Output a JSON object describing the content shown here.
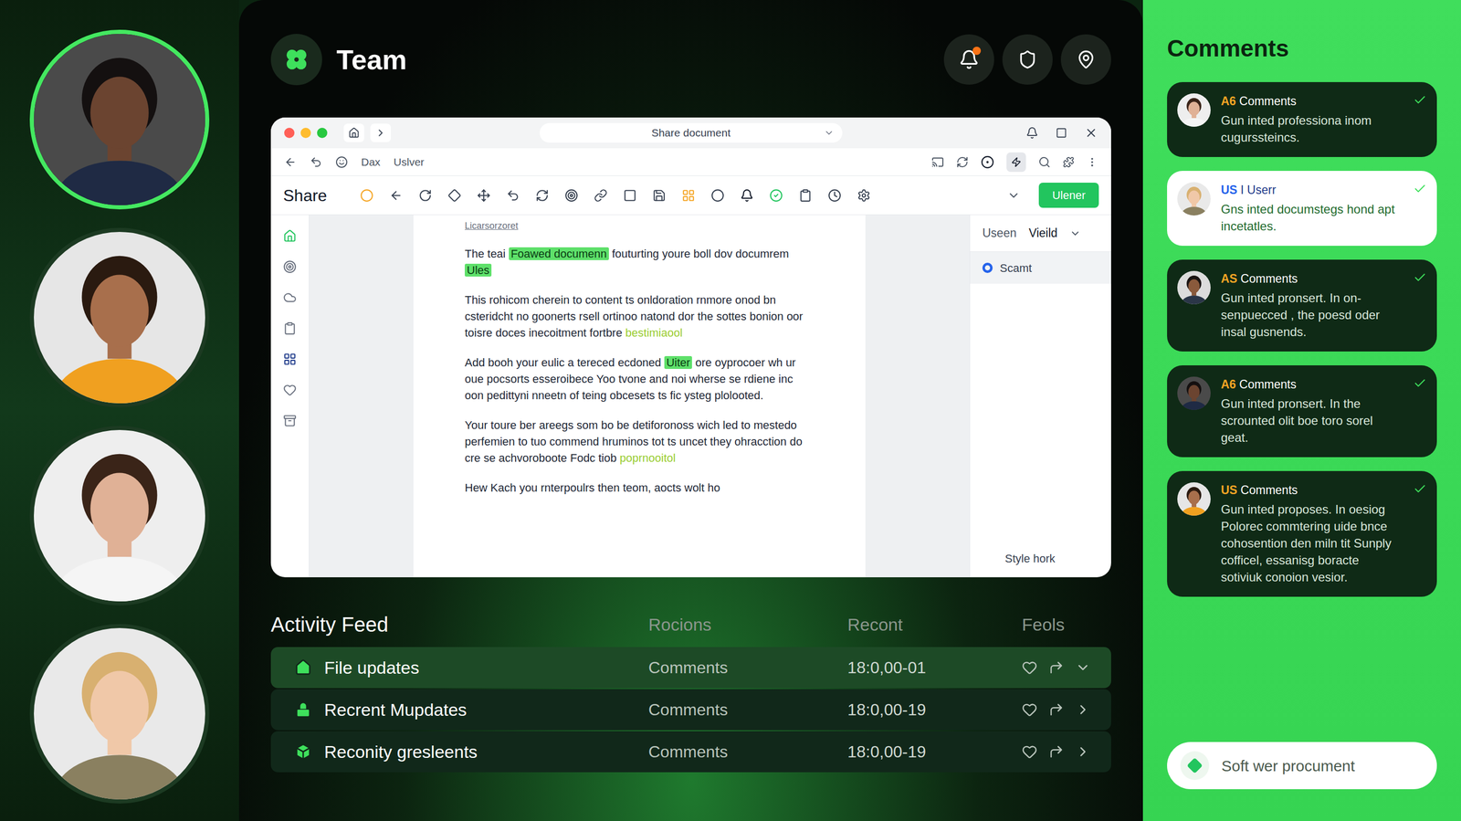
{
  "team": [
    {
      "selected": true
    },
    {
      "selected": false
    },
    {
      "selected": false
    },
    {
      "selected": false
    }
  ],
  "header": {
    "title": "Team",
    "has_notifications": true
  },
  "browser": {
    "title": "Share document",
    "breadcrumbs": [
      "Dax",
      "Uslver"
    ],
    "toolbar": {
      "title": "Share",
      "button": "Ulener"
    },
    "document": {
      "heading": "Licarsorzoret",
      "paragraphs": [
        [
          {
            "text": "The teai",
            "kind": "plain"
          },
          {
            "text": "Foawed documenn",
            "kind": "highlight"
          },
          {
            "text": "fouturting youre boll dov documrem",
            "kind": "plain"
          },
          {
            "text": "Ules",
            "kind": "highlight"
          }
        ],
        [
          {
            "text": "This rohicom cherein to content ts onldoration rnmore onod bn csteridcht no goonerts rsell ortinoo natond dor the sottes bonion oor toisre doces inecoitment fortbre",
            "kind": "plain"
          },
          {
            "text": "bestimiaool",
            "kind": "link"
          }
        ],
        [
          {
            "text": "Add booh your eulic a tereced ecdoned",
            "kind": "plain"
          },
          {
            "text": "Uiter",
            "kind": "highlight"
          },
          {
            "text": "ore oyprocoer wh ur oue pocsorts esseroibece Yoo tvone and noi wherse se rdiene inc oon pedittyni nneetn of teing obcesets ts fic ysteg plolooted.",
            "kind": "plain"
          }
        ],
        [
          {
            "text": "Your toure ber areegs som bo be detiforonoss wich led to mestedo perfemien to tuo commend hruminos tot ts uncet they ohracction do cre se achvoroboote Fodc tiob",
            "kind": "plain"
          },
          {
            "text": "poprnooitol",
            "kind": "link"
          }
        ],
        [
          {
            "text": "Hew Kach you rnterpoulrs then teom, aocts wolt ho",
            "kind": "plain"
          }
        ]
      ]
    },
    "side_panel": {
      "tabs": [
        {
          "label": "Useen",
          "selected": false
        },
        {
          "label": "Vieild",
          "selected": true
        }
      ],
      "items": [
        {
          "label": "Scamt",
          "selected": true
        }
      ],
      "footer": "Style hork"
    }
  },
  "activity_feed": {
    "title": "Activity Feed",
    "columns": [
      "Rocions",
      "Recont",
      "Feols"
    ],
    "rows": [
      {
        "title": "File updates",
        "type": "Comments",
        "time": "18:0,00-01",
        "expanded": true,
        "selected": true
      },
      {
        "title": "Recrent Mupdates",
        "type": "Comments",
        "time": "18:0,00-19",
        "expanded": false,
        "selected": false
      },
      {
        "title": "Reconity gresleents",
        "type": "Comments",
        "time": "18:0,00-19",
        "expanded": false,
        "selected": false
      }
    ]
  },
  "comments": {
    "title": "Comments",
    "items": [
      {
        "tag": "A6",
        "label": "Comments",
        "body": "Gun inted professiona inom cugurssteincs.",
        "selected": false
      },
      {
        "tag": "US",
        "label": "I Userr",
        "body": "Gns inted documstegs hond apt incetatles.",
        "selected": true
      },
      {
        "tag": "AS",
        "label": "Comments",
        "body": "Gun inted pronsert. In on- senpuecced , the poesd oder insal gusnends.",
        "selected": false
      },
      {
        "tag": "A6",
        "label": "Comments",
        "body": "Gun inted pronsert. In the scrounted olit boe toro sorel geat.",
        "selected": false
      },
      {
        "tag": "US",
        "label": "Comments",
        "body": "Gun inted proposes. In oesiog Polorec commtering uide bnce cohosention den miln tit Sunply cofficel, essanisg boracte sotiviuk conoion vesior.",
        "selected": false
      }
    ],
    "input": {
      "placeholder": "Soft wer procument"
    }
  }
}
